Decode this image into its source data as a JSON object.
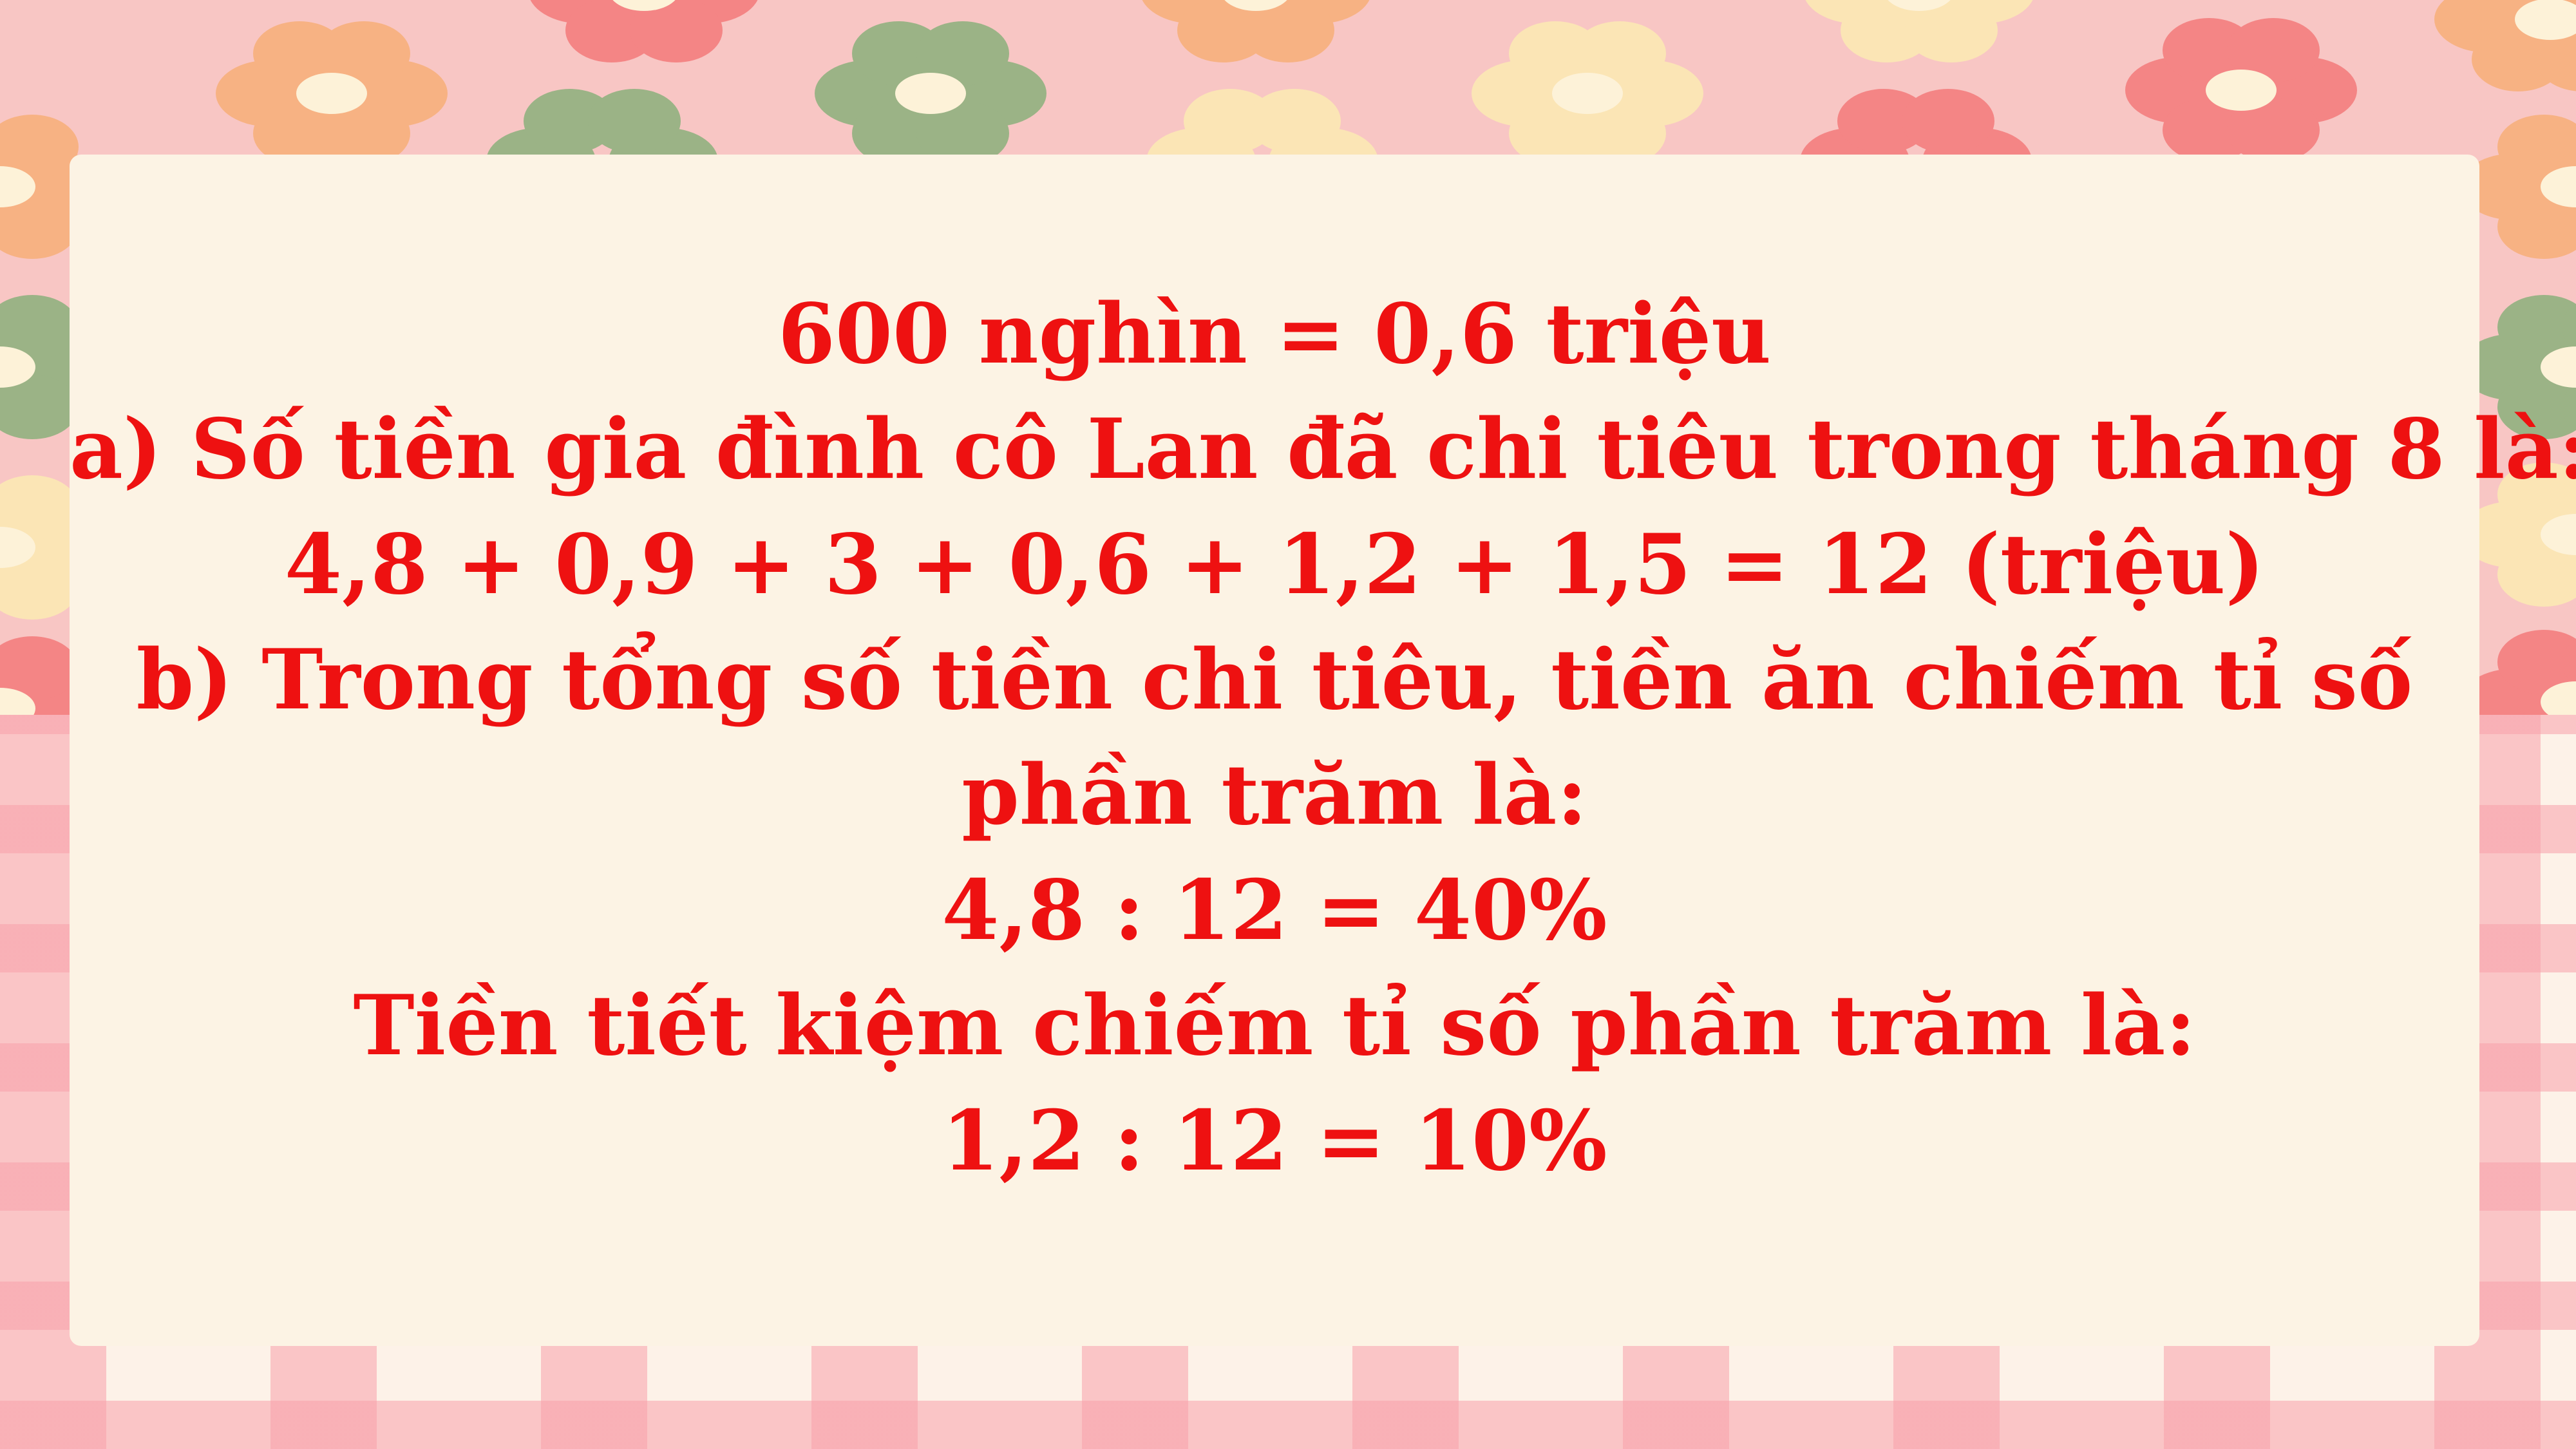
{
  "colors": {
    "text": "#ee1111",
    "card": "#fcf3e4",
    "band_pink": "#f8c6c4",
    "flower_orange": "#f7b283",
    "flower_green": "#9bb386",
    "flower_cream": "#fbe5b5",
    "flower_red": "#f48585",
    "flower_center": "#fdf2d8"
  },
  "content": {
    "lines": [
      "600 nghìn = 0,6 triệu",
      "a) Số tiền gia đình cô Lan đã chi tiêu trong tháng 8 là:",
      "4,8 + 0,9 + 3 + 0,6 + 1,2 + 1,5 = 12 (triệu)",
      "b) Trong tổng số tiền chi tiêu, tiền ăn chiếm tỉ số",
      "phần trăm là:",
      "4,8 : 12 = 40%",
      "Tiền tiết kiệm chiếm tỉ số phần trăm là:",
      "1,2 : 12 = 10%"
    ]
  }
}
